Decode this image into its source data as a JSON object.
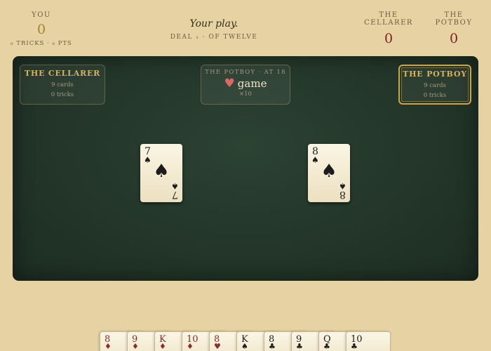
{
  "header": {
    "you": {
      "label": "YOU",
      "score": "0",
      "sub": "₀ TRICKS · ₀ PTS"
    },
    "status": "Your play.",
    "deal": "DEAL ₁ · OF TWELVE",
    "opponents": [
      {
        "label": "THE CELLARER",
        "score": "0"
      },
      {
        "label": "THE POTBOY",
        "score": "0"
      }
    ]
  },
  "table": {
    "seat_left": {
      "name": "THE CELLARER",
      "cards": "9 cards",
      "tricks": "0 tricks"
    },
    "seat_right": {
      "name": "THE POTBOY",
      "cards": "9 cards",
      "tricks": "0 tricks"
    },
    "bid": {
      "head": "THE POTBOY · AT 18",
      "suit_symbol": "♥",
      "contract": "game",
      "multiplier": "×10"
    },
    "played_cards": [
      {
        "rank": "7",
        "suit": "♠",
        "color": "black"
      },
      {
        "rank": "8",
        "suit": "♠",
        "color": "black"
      }
    ]
  },
  "hand": [
    {
      "rank": "8",
      "suit": "♦",
      "color": "red"
    },
    {
      "rank": "9",
      "suit": "♦",
      "color": "red"
    },
    {
      "rank": "K",
      "suit": "♦",
      "color": "red"
    },
    {
      "rank": "10",
      "suit": "♦",
      "color": "red"
    },
    {
      "rank": "8",
      "suit": "♥",
      "color": "red"
    },
    {
      "rank": "K",
      "suit": "♠",
      "color": "black"
    },
    {
      "rank": "8",
      "suit": "♣",
      "color": "black"
    },
    {
      "rank": "9",
      "suit": "♣",
      "color": "black"
    },
    {
      "rank": "Q",
      "suit": "♣",
      "color": "black"
    },
    {
      "rank": "10",
      "suit": "♣",
      "color": "black"
    }
  ],
  "colors": {
    "felt": "#233629",
    "gold": "#d6b25e",
    "red_suit": "#8c2a2e",
    "heart_accent": "#d86a63"
  }
}
